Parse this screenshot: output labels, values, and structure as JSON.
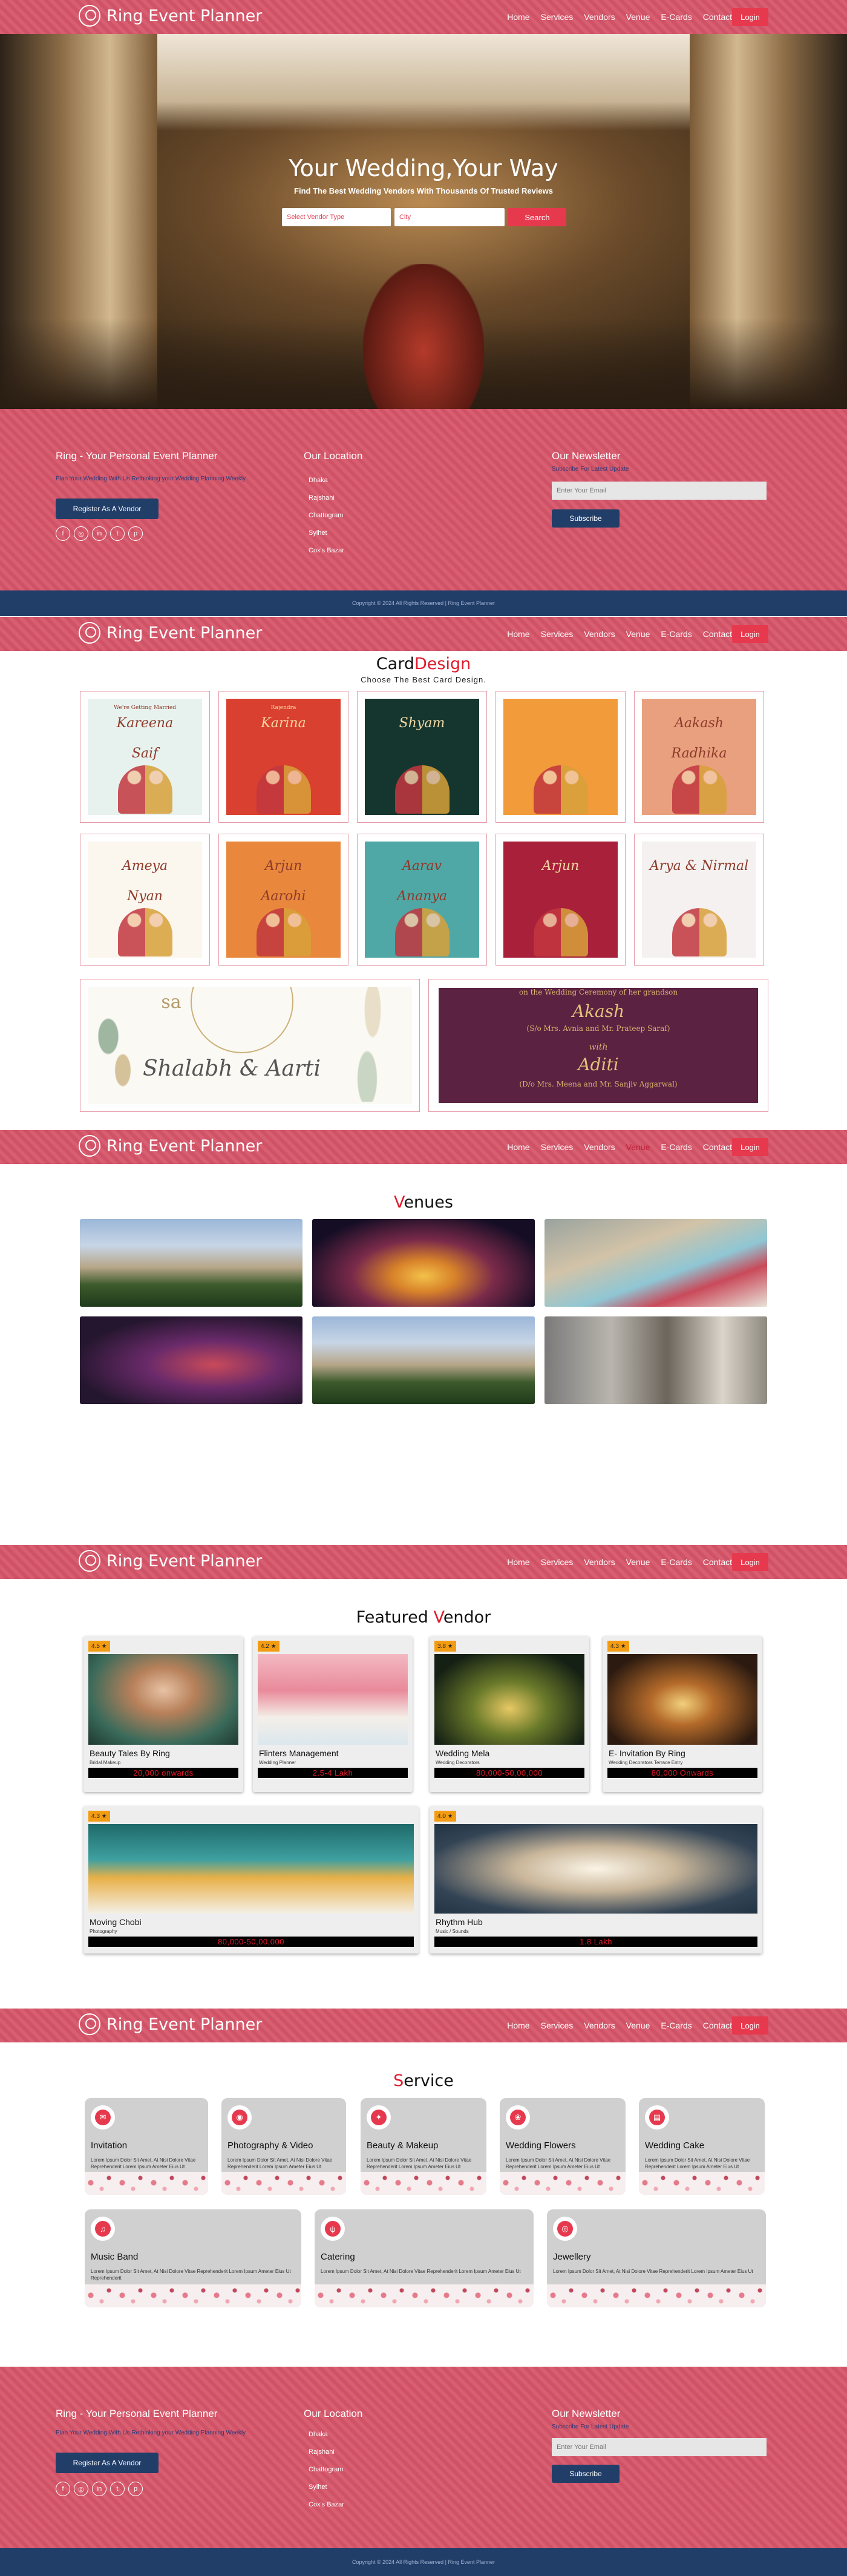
{
  "brand": "Ring Event Planner",
  "nav": {
    "links": [
      "Home",
      "Services",
      "Vendors",
      "Venue",
      "E-Cards",
      "Contact"
    ],
    "login": "Login"
  },
  "hero": {
    "title": "Your Wedding,Your Way",
    "subtitle": "Find The Best Wedding Vendors With Thousands Of Trusted Reviews",
    "vendor_type": "Select Vendor Type",
    "city": "City",
    "search": "Search"
  },
  "footer": {
    "about_title": "Ring - Your Personal Event Planner",
    "tagline": "Plan Your Wedding With Us Rethinking your Wedding Planning Weekly",
    "register": "Register As A Vendor",
    "location_title": "Our Location",
    "locations": [
      "Dhaka",
      "Rajshahi",
      "Chattogram",
      "Sylhet",
      "Cox's Bazar"
    ],
    "newsletter_title": "Our Newsletter",
    "newsletter_sub": "Subscribe For Latest Update",
    "email_placeholder": "Enter Your Email",
    "subscribe": "Subscribe",
    "copyright": "Copyright © 2024 All Rights Reserved | Ring Event Planner",
    "social_icons": [
      "facebook-icon",
      "instagram-icon",
      "linkedin-icon",
      "twitter-icon",
      "pinterest-icon"
    ]
  },
  "cards": {
    "title_a": "Card",
    "title_b": "Design",
    "subtitle": "Choose The Best Card Design.",
    "row1": [
      {
        "line1": "We're Getting Married",
        "name1": "Kareena",
        "name2": "Saif",
        "bg": "#e7f2ee"
      },
      {
        "line1": "Rajendra",
        "name1": "Karina",
        "name2": "",
        "bg": "#d9402f"
      },
      {
        "line1": "",
        "name1": "Shyam",
        "name2": "",
        "bg": "#15362f"
      },
      {
        "line1": "",
        "name1": "",
        "name2": "",
        "bg": "#f19b3a"
      },
      {
        "line1": "",
        "name1": "Aakash",
        "name2": "Radhika",
        "bg": "#e8a07e"
      }
    ],
    "row2": [
      {
        "line1": "",
        "name1": "Ameya",
        "name2": "Nyan",
        "bg": "#fbf7ef"
      },
      {
        "line1": "",
        "name1": "Arjun",
        "name2": "Aarohi",
        "bg": "#e9883c"
      },
      {
        "line1": "",
        "name1": "Aarav",
        "name2": "Ananya",
        "bg": "#4fa8a6"
      },
      {
        "line1": "",
        "name1": "Arjun",
        "name2": "",
        "bg": "#a8203a"
      },
      {
        "line1": "",
        "name1": "Arya & Nirmal",
        "name2": "",
        "bg": "#f4f1f0"
      }
    ],
    "wide1": {
      "mono": "sa",
      "names": "Shalabh & Aarti"
    },
    "wide2": {
      "line1": "on the Wedding Ceremony of her grandson",
      "name1": "Akash",
      "line2": "(S/o Mrs. Avnia and Mr. Prateep Saraf)",
      "with": "with",
      "name2": "Aditi",
      "line3": "(D/o Mrs. Meena and Mr. Sanjiv Aggarwal)"
    }
  },
  "venues": {
    "title_a": "V",
    "title_b": "enues"
  },
  "featured": {
    "title_a": "Featured ",
    "title_b": "V",
    "title_c": "endor",
    "vendors": [
      {
        "rating": "4.5 ★",
        "name": "Beauty Tales By Ring",
        "cat": "Bridal Makeup",
        "price": "20,000 onwards"
      },
      {
        "rating": "4.2 ★",
        "name": "Flinters Management",
        "cat": "Wedding Planner",
        "price": "2.5-4 Lakh"
      },
      {
        "rating": "3.8 ★",
        "name": "Wedding Mela",
        "cat": "Wedding Decorators",
        "price": "80,000-50,00,000"
      },
      {
        "rating": "4.3 ★",
        "name": "E- Invitation By Ring",
        "cat": "Wedding Decorators Terrace Entry",
        "price": "80,000 Onwards"
      },
      {
        "rating": "4.3 ★",
        "name": "Moving Chobi",
        "cat": "Photography",
        "price": "80,000-50,00,000"
      },
      {
        "rating": "4.0 ★",
        "name": "Rhythm Hub",
        "cat": "Music / Sounds",
        "price": "1.8 Lakh"
      }
    ]
  },
  "service": {
    "title_a": "S",
    "title_b": "ervice",
    "items": [
      {
        "name": "Invitation",
        "icon": "book-icon",
        "glyph": "✉",
        "desc": "Lorem Ipsum Dolor Sit Amet, At Nisi Dolore Vitae Reprehenderit Lorem Ipsum Ameter Eius Ut"
      },
      {
        "name": "Photography & Video",
        "icon": "camera-icon",
        "glyph": "◉",
        "desc": "Lorem Ipsum Dolor Sit Amet, At Nisi Dolore Vitae Reprehenderit Lorem Ipsum Ameter Eius Ut"
      },
      {
        "name": "Beauty & Makeup",
        "icon": "makeup-icon",
        "glyph": "✦",
        "desc": "Lorem Ipsum Dolor Sit Amet, At Nisi Dolore Vitae Reprehenderit Lorem Ipsum Ameter Eius Ut"
      },
      {
        "name": "Wedding Flowers",
        "icon": "flower-icon",
        "glyph": "❀",
        "desc": "Lorem Ipsum Dolor Sit Amet, At Nisi Dolore Vitae Reprehenderit Lorem Ipsum Ameter Eius Ut"
      },
      {
        "name": "Wedding Cake",
        "icon": "cake-icon",
        "glyph": "▤",
        "desc": "Lorem Ipsum Dolor Sit Amet, At Nisi Dolore Vitae Reprehenderit Lorem Ipsum Ameter Eius Ut"
      },
      {
        "name": "Music Band",
        "icon": "music-icon",
        "glyph": "♫",
        "desc": "Lorem Ipsum Dolor Sit Amet, At Nisi Dolore Vitae Reprehenderit Lorem Ipsum Ameter Eius Ut Reprehenderit"
      },
      {
        "name": "Catering",
        "icon": "utensils-icon",
        "glyph": "ψ",
        "desc": "Lorem Ipsum Dolor Sit Amet, At Nisi Dolore Vitae Reprehenderit Lorem Ipsum Ameter Eius Ut"
      },
      {
        "name": "Jewellery",
        "icon": "ring-icon",
        "glyph": "◎",
        "desc": "Lorem Ipsum Dolor Sit Amet, At Nisi Dolore Vitae Reprehenderit Lorem Ipsum Ameter Eius Ut"
      }
    ]
  },
  "colors": {
    "accent": "#d65569",
    "button": "#e7394e",
    "navy": "#213e69",
    "title_red": "#e0192b"
  }
}
